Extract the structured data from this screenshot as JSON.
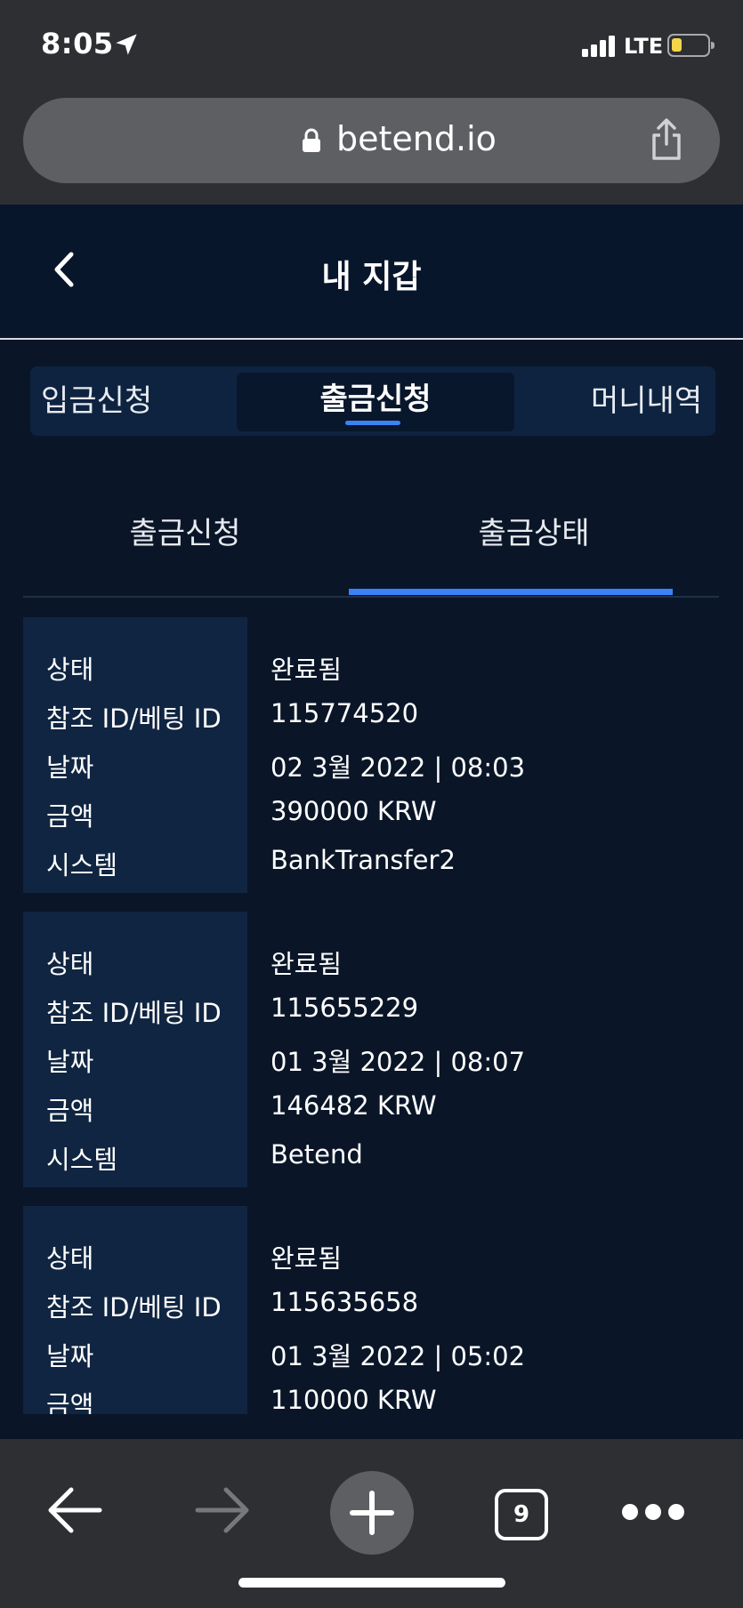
{
  "status_bar": {
    "time": "8:05",
    "network": "LTE",
    "battery_level": 0.3,
    "battery_color": "#f5d549"
  },
  "browser": {
    "url": "betend.io",
    "tab_count": "9"
  },
  "header": {
    "title": "내 지갑"
  },
  "main_tabs": [
    {
      "label": "입금신청",
      "active": false
    },
    {
      "label": "출금신청",
      "active": true
    },
    {
      "label": "머니내역",
      "active": false
    }
  ],
  "sub_tabs": [
    {
      "label": "출금신청",
      "active": false
    },
    {
      "label": "출금상태",
      "active": true
    }
  ],
  "labels": {
    "status": "상태",
    "ref_id": "참조 ID/베팅 ID",
    "date": "날짜",
    "amount": "금액",
    "system": "시스템"
  },
  "records": [
    {
      "status": "완료됨",
      "ref_id": "115774520",
      "date": "02 3월 2022 | 08:03",
      "amount": "390000 KRW",
      "system": "BankTransfer2"
    },
    {
      "status": "완료됨",
      "ref_id": "115655229",
      "date": "01 3월 2022 | 08:07",
      "amount": "146482 KRW",
      "system": "Betend"
    },
    {
      "status": "완료됨",
      "ref_id": "115635658",
      "date": "01 3월 2022 | 05:02",
      "amount": "110000 KRW"
    }
  ],
  "colors": {
    "page_bg": "#0a1628",
    "label_panel": "#102541",
    "accent": "#3b82f6",
    "browser_chrome": "#2e2f33"
  },
  "icons": {
    "location": "location-arrow-icon",
    "lock": "lock-icon",
    "share": "share-icon",
    "back": "chevron-left-icon",
    "nav_back": "arrow-left-icon",
    "nav_forward": "arrow-right-icon",
    "new_tab": "plus-icon",
    "more": "ellipsis-icon"
  }
}
